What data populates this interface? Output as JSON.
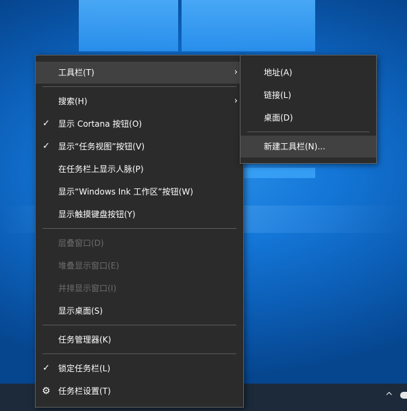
{
  "main_menu": {
    "items": [
      {
        "label": "工具栏(T)",
        "has_submenu": true,
        "highlighted": true
      },
      {
        "label": "搜索(H)",
        "has_submenu": true
      },
      {
        "label": "显示 Cortana 按钮(O)",
        "checked": true
      },
      {
        "label": "显示“任务视图”按钮(V)",
        "checked": true
      },
      {
        "label": "在任务栏上显示人脉(P)"
      },
      {
        "label": "显示“Windows Ink 工作区”按钮(W)"
      },
      {
        "label": "显示触摸键盘按钮(Y)"
      },
      {
        "label": "层叠窗口(D)",
        "disabled": true
      },
      {
        "label": "堆叠显示窗口(E)",
        "disabled": true
      },
      {
        "label": "并排显示窗口(I)",
        "disabled": true
      },
      {
        "label": "显示桌面(S)"
      },
      {
        "label": "任务管理器(K)"
      },
      {
        "label": "锁定任务栏(L)",
        "checked": true
      },
      {
        "label": "任务栏设置(T)",
        "icon": "gear-icon"
      }
    ]
  },
  "toolbar_submenu": {
    "items": [
      {
        "label": "地址(A)"
      },
      {
        "label": "链接(L)"
      },
      {
        "label": "桌面(D)"
      },
      {
        "label": "新建工具栏(N)...",
        "highlighted": true
      }
    ]
  },
  "glyphs": {
    "check": "✓",
    "arrow": "›",
    "gear": "⚙",
    "tray_chevron": "^"
  },
  "colors": {
    "menu_bg": "#2b2b2b",
    "menu_hover": "#414141",
    "menu_border": "#606060",
    "disabled_text": "#6d6d6d",
    "desktop_blue": "#1477d8",
    "taskbar": "#1c2a3a"
  }
}
